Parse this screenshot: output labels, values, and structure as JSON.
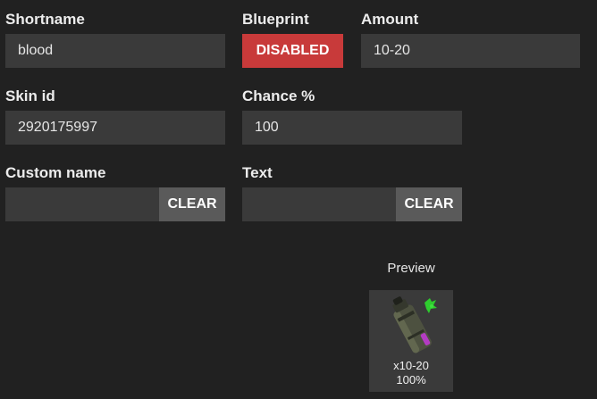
{
  "form": {
    "shortname": {
      "label": "Shortname",
      "value": "blood"
    },
    "blueprint": {
      "label": "Blueprint",
      "button": "DISABLED",
      "state_color": "#c83a3a"
    },
    "amount": {
      "label": "Amount",
      "value": "10-20"
    },
    "skin_id": {
      "label": "Skin id",
      "value": "2920175997"
    },
    "chance": {
      "label": "Chance %",
      "value": "100"
    },
    "custom_name": {
      "label": "Custom name",
      "value": "",
      "clear_label": "CLEAR"
    },
    "text": {
      "label": "Text",
      "value": "",
      "clear_label": "CLEAR"
    }
  },
  "preview": {
    "label": "Preview",
    "icon": "blood-canister-icon",
    "amount_text": "x10-20",
    "chance_text": "100%"
  }
}
